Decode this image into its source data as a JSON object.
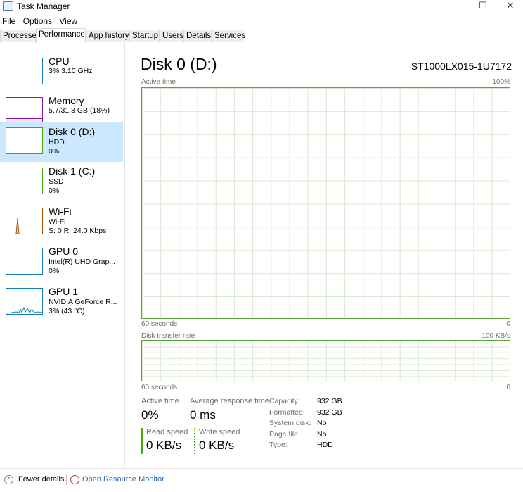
{
  "window": {
    "title": "Task Manager",
    "minimize": "—",
    "maximize": "☐",
    "close": "✕"
  },
  "menu": [
    "File",
    "Options",
    "View"
  ],
  "tabs": [
    "Processes",
    "Performance",
    "App history",
    "Startup",
    "Users",
    "Details",
    "Services"
  ],
  "sidebar": [
    {
      "name": "CPU",
      "sub1": "3% 3.10 GHz",
      "sub2": "",
      "color": "#117dbb"
    },
    {
      "name": "Memory",
      "sub1": "5.7/31.8 GB (18%)",
      "sub2": "",
      "color": "#8b12ae"
    },
    {
      "name": "Disk 0 (D:)",
      "sub1": "HDD",
      "sub2": "0%",
      "color": "#4da60c"
    },
    {
      "name": "Disk 1 (C:)",
      "sub1": "SSD",
      "sub2": "0%",
      "color": "#4da60c"
    },
    {
      "name": "Wi-Fi",
      "sub1": "Wi-Fi",
      "sub2": "S: 0 R: 24.0 Kbps",
      "color": "#a74f01"
    },
    {
      "name": "GPU 0",
      "sub1": "Intel(R) UHD Grap...",
      "sub2": "0%",
      "color": "#117dbb"
    },
    {
      "name": "GPU 1",
      "sub1": "NVIDIA GeForce R...",
      "sub2": "3% (43 °C)",
      "color": "#117dbb"
    }
  ],
  "main": {
    "title": "Disk 0 (D:)",
    "model": "ST1000LX015-1U7172",
    "graph1": {
      "label": "Active time",
      "max": "100%",
      "time": "60 seconds",
      "min": "0"
    },
    "graph2": {
      "label": "Disk transfer rate",
      "max": "100 KB/s",
      "time": "60 seconds",
      "min": "0"
    },
    "stats": {
      "active_time_label": "Active time",
      "active_time": "0%",
      "resp_label": "Average response time",
      "resp": "0 ms",
      "read_label": "Read speed",
      "read": "0 KB/s",
      "write_label": "Write speed",
      "write": "0 KB/s"
    },
    "props": [
      {
        "k": "Capacity:",
        "v": "932 GB"
      },
      {
        "k": "Formatted:",
        "v": "932 GB"
      },
      {
        "k": "System disk:",
        "v": "No"
      },
      {
        "k": "Page file:",
        "v": "No"
      },
      {
        "k": "Type:",
        "v": "HDD"
      }
    ]
  },
  "footer": {
    "fewer": "Fewer details",
    "monitor": "Open Resource Monitor"
  }
}
